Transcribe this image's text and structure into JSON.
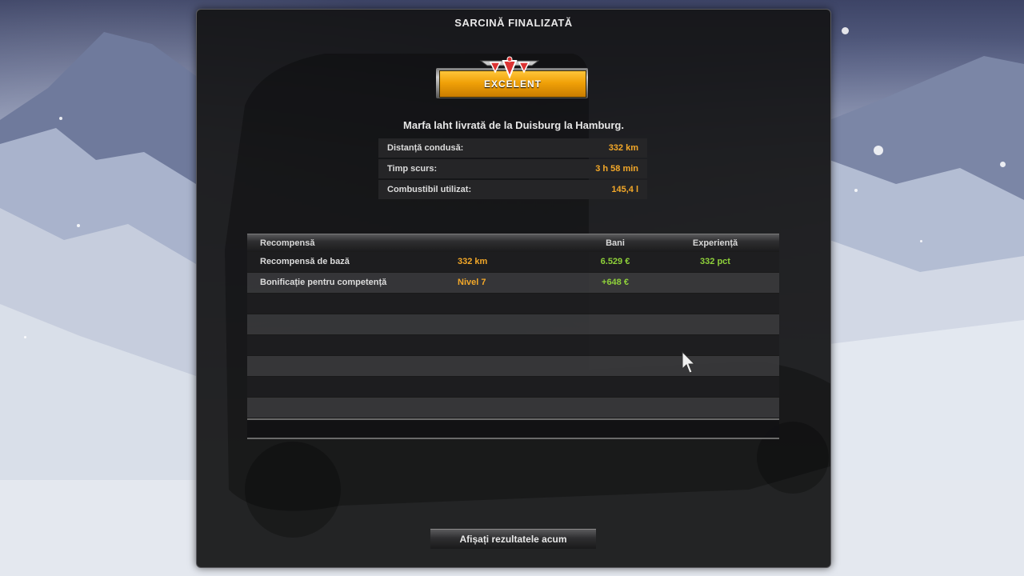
{
  "window": {
    "title": "SARCINĂ FINALIZATĂ"
  },
  "rating": {
    "label": "EXCELENT",
    "color": "#f0a108"
  },
  "delivery_text": "Marfa laht livrată de la Duisburg la Hamburg.",
  "stats": [
    {
      "label": "Distanță condusă:",
      "value": "332 km"
    },
    {
      "label": "Timp scurs:",
      "value": "3 h 58 min"
    },
    {
      "label": "Combustibil utilizat:",
      "value": "145,4 l"
    }
  ],
  "rewards": {
    "headers": {
      "reward": "Recompensă",
      "money": "Bani",
      "xp": "Experiență"
    },
    "rows": [
      {
        "name": "Recompensă de bază",
        "detail": "332 km",
        "money": "6.529 €",
        "xp": "332 pct"
      },
      {
        "name": "Bonificație pentru competență",
        "detail": "Nivel 7",
        "money": "+648 €",
        "xp": ""
      }
    ]
  },
  "results_button": "Afișați rezultatele acum",
  "colors": {
    "accent": "#f3a829",
    "positive": "#8fd13a",
    "panel": "#141416"
  }
}
